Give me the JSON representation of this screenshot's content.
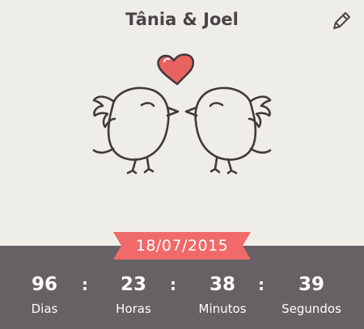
{
  "header": {
    "title": "Tânia & Joel",
    "edit_icon": "pencil-icon"
  },
  "illustration": {
    "description_icons": [
      "bird-left",
      "bird-right",
      "heart-icon"
    ],
    "heart_color": "#e8625f",
    "line_color": "#3f3a3c"
  },
  "event": {
    "date": "18/07/2015",
    "ribbon_color": "#f06a6a"
  },
  "countdown": {
    "background": "#676065",
    "separator": ":",
    "days": {
      "value": "96",
      "label": "Dias"
    },
    "hours": {
      "value": "23",
      "label": "Horas"
    },
    "minutes": {
      "value": "38",
      "label": "Minutos"
    },
    "seconds": {
      "value": "39",
      "label": "Segundos"
    }
  }
}
